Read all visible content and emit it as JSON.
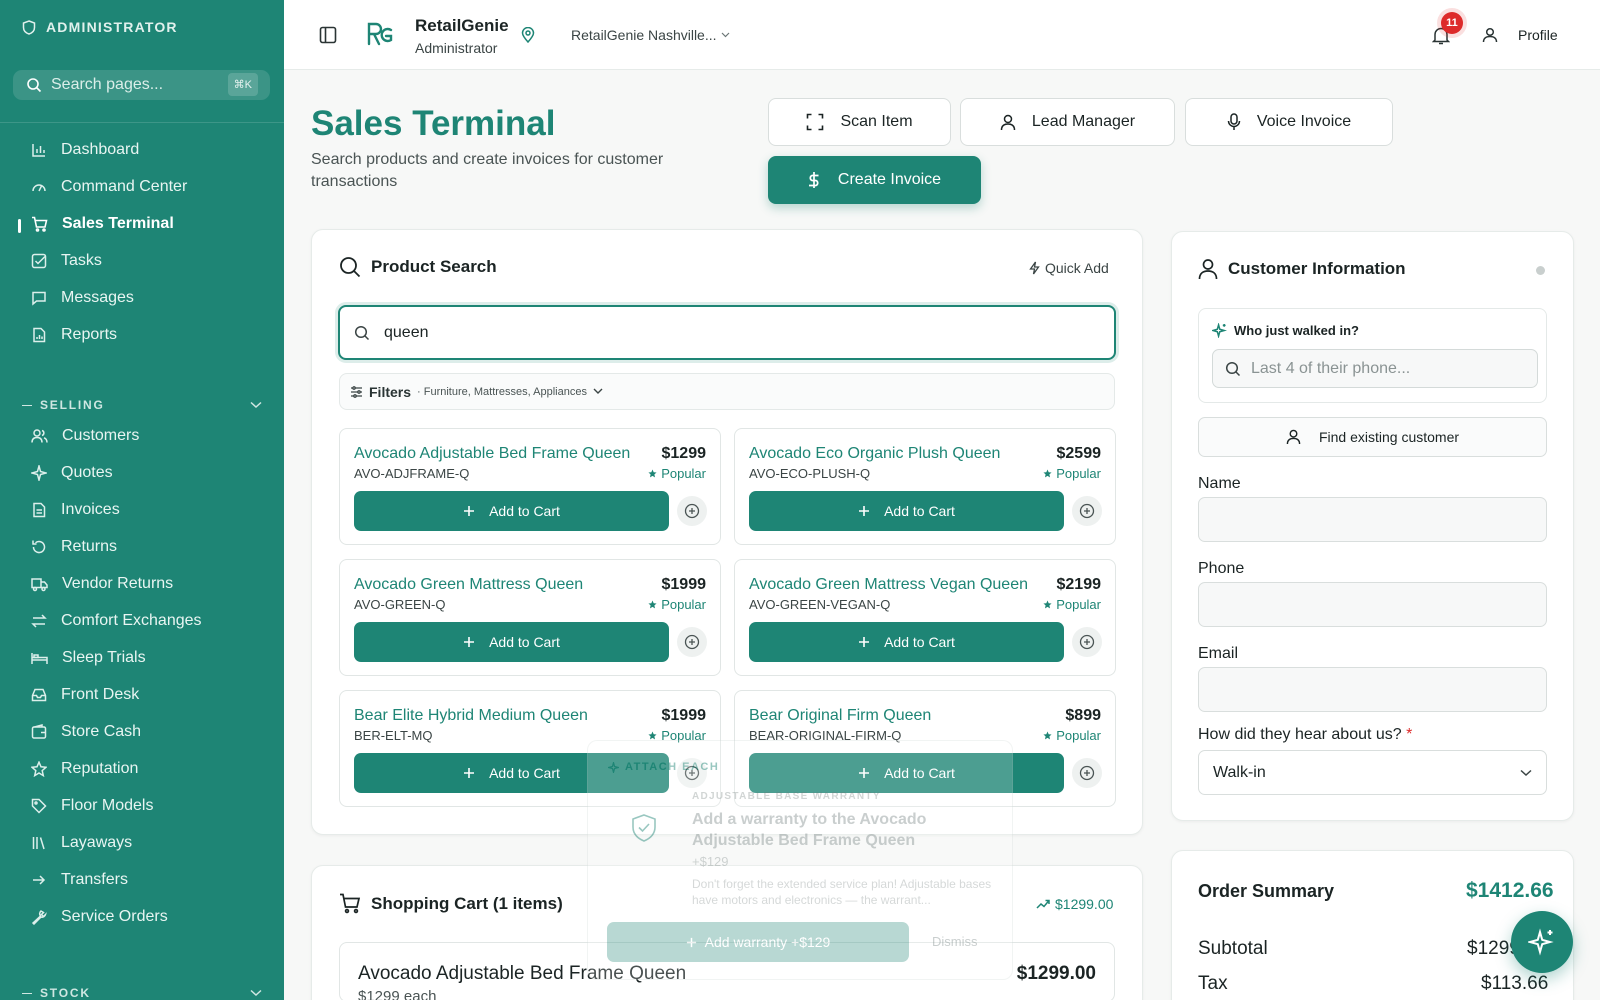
{
  "sidebar": {
    "role": "ADMINISTRATOR",
    "search_placeholder": "Search pages...",
    "search_kbd": "⌘K",
    "main_items": [
      {
        "label": "Dashboard",
        "icon": "bar-chart-icon"
      },
      {
        "label": "Command Center",
        "icon": "gauge-icon"
      },
      {
        "label": "Sales Terminal",
        "icon": "cart-icon",
        "active": true
      },
      {
        "label": "Tasks",
        "icon": "checkbox-icon"
      },
      {
        "label": "Messages",
        "icon": "message-icon"
      },
      {
        "label": "Reports",
        "icon": "file-chart-icon"
      }
    ],
    "selling_label": "SELLING",
    "selling_items": [
      {
        "label": "Customers",
        "icon": "users-icon"
      },
      {
        "label": "Quotes",
        "icon": "sparkle-icon"
      },
      {
        "label": "Invoices",
        "icon": "file-icon"
      },
      {
        "label": "Returns",
        "icon": "rotate-ccw-icon"
      },
      {
        "label": "Vendor Returns",
        "icon": "truck-icon"
      },
      {
        "label": "Comfort Exchanges",
        "icon": "exchange-icon"
      },
      {
        "label": "Sleep Trials",
        "icon": "bed-icon"
      },
      {
        "label": "Front Desk",
        "icon": "inbox-icon"
      },
      {
        "label": "Store Cash",
        "icon": "wallet-icon"
      },
      {
        "label": "Reputation",
        "icon": "star-icon"
      },
      {
        "label": "Floor Models",
        "icon": "tag-icon"
      },
      {
        "label": "Layaways",
        "icon": "library-icon"
      },
      {
        "label": "Transfers",
        "icon": "arrow-right-icon"
      },
      {
        "label": "Service Orders",
        "icon": "wrench-icon"
      }
    ],
    "stock_label": "STOCK"
  },
  "topbar": {
    "brand_name": "RetailGenie",
    "brand_role": "Administrator",
    "location": "RetailGenie Nashville...",
    "notifications": "11",
    "profile": "Profile"
  },
  "page": {
    "title": "Sales Terminal",
    "subtitle": "Search products and create invoices for customer transactions"
  },
  "actions": {
    "scan": "Scan Item",
    "lead": "Lead Manager",
    "voice": "Voice Invoice",
    "create": "Create Invoice"
  },
  "product_search": {
    "title": "Product Search",
    "quick_add": "Quick Add",
    "query": "queen",
    "filters_label": "Filters",
    "filters_summary": "· Furniture, Mattresses, Appliances",
    "add_label": "Add to Cart",
    "products": [
      {
        "name": "Avocado Adjustable Bed Frame Queen",
        "sku": "AVO-ADJFRAME-Q",
        "price": "$1299",
        "tag": "Popular"
      },
      {
        "name": "Avocado Eco Organic Plush Queen",
        "sku": "AVO-ECO-PLUSH-Q",
        "price": "$2599",
        "tag": "Popular"
      },
      {
        "name": "Avocado Green Mattress Queen",
        "sku": "AVO-GREEN-Q",
        "price": "$1999",
        "tag": "Popular"
      },
      {
        "name": "Avocado Green Mattress Vegan Queen",
        "sku": "AVO-GREEN-VEGAN-Q",
        "price": "$2199",
        "tag": "Popular"
      },
      {
        "name": "Bear Elite Hybrid Medium Queen",
        "sku": "BER-ELT-MQ",
        "price": "$1999",
        "tag": "Popular"
      },
      {
        "name": "Bear Original Firm Queen",
        "sku": "BEAR-ORIGINAL-FIRM-Q",
        "price": "$899",
        "tag": "Popular"
      }
    ]
  },
  "cart": {
    "title": "Shopping Cart (1 items)",
    "total_trend": "$1299.00",
    "item_name": "Avocado Adjustable Bed Frame Queen",
    "item_each": "$1299 each",
    "item_total": "$1299.00"
  },
  "warranty_popup": {
    "attach": "ATTACH EACH",
    "kicker": "ADJUSTABLE BASE WARRANTY",
    "title": "Add a warranty to the Avocado Adjustable Bed Frame Queen",
    "price": "+$129",
    "desc": "Don't forget the extended service plan! Adjustable bases have motors and electronics — the warrant...",
    "add": "Add warranty +$129",
    "dismiss": "Dismiss"
  },
  "customer": {
    "title": "Customer Information",
    "walk_in_title": "Who just walked in?",
    "phone_placeholder": "Last 4 of their phone...",
    "find_existing": "Find existing customer",
    "name_label": "Name",
    "phone_label": "Phone",
    "email_label": "Email",
    "source_label": "How did they hear about us?",
    "required_mark": "*",
    "source_value": "Walk-in"
  },
  "order_summary": {
    "title": "Order Summary",
    "total": "$1412.66",
    "subtotal_label": "Subtotal",
    "subtotal": "$1299.00",
    "tax_label": "Tax",
    "tax": "$113.66"
  },
  "colors": {
    "brand": "#1e8575",
    "danger": "#dd2a2a"
  }
}
